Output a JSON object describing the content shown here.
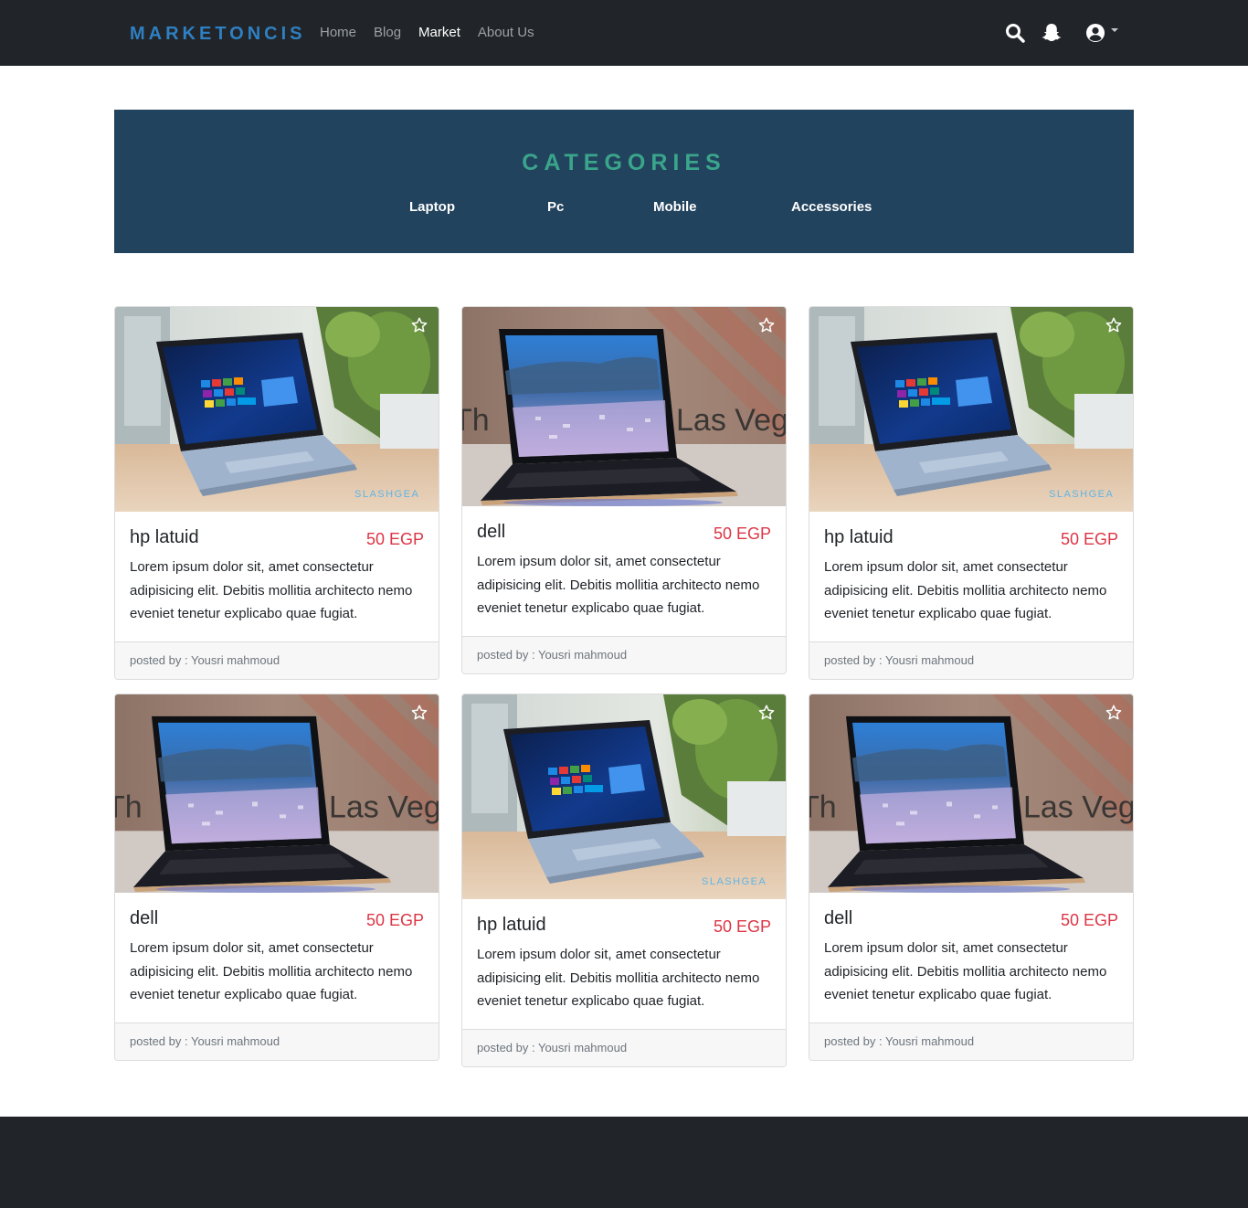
{
  "navbar": {
    "brand": "MARKETONCIS",
    "links": [
      {
        "label": "Home",
        "active": false
      },
      {
        "label": "Blog",
        "active": false
      },
      {
        "label": "Market",
        "active": true
      },
      {
        "label": "About Us",
        "active": false
      }
    ],
    "icons": [
      "search-icon",
      "snapchat-icon",
      "user-circle-icon",
      "caret-down-icon"
    ]
  },
  "categories": {
    "title": "CATEGORIES",
    "items": [
      "Laptop",
      "Pc",
      "Mobile",
      "Accessories"
    ]
  },
  "products": [
    {
      "name": "hp latuid",
      "price": "50 EGP",
      "description": "Lorem ipsum dolor sit, amet consectetur adipisicing elit. Debitis mollitia architecto nemo eveniet tenetur explicabo quae fugiat.",
      "posted_by": "posted by : Yousri mahmoud",
      "image": "surface-laptop",
      "watermark": "SLASHGEAR"
    },
    {
      "name": "dell",
      "price": "50 EGP",
      "description": "Lorem ipsum dolor sit, amet consectetur adipisicing elit. Debitis mollitia architecto nemo eveniet tenetur explicabo quae fugiat.",
      "posted_by": "posted by : Yousri mahmoud",
      "image": "dell-laptop",
      "backdrop_text": "Th Las Veg"
    },
    {
      "name": "hp latuid",
      "price": "50 EGP",
      "description": "Lorem ipsum dolor sit, amet consectetur adipisicing elit. Debitis mollitia architecto nemo eveniet tenetur explicabo quae fugiat.",
      "posted_by": "posted by : Yousri mahmoud",
      "image": "surface-laptop",
      "watermark": "SLASHGEAR"
    },
    {
      "name": "dell",
      "price": "50 EGP",
      "description": "Lorem ipsum dolor sit, amet consectetur adipisicing elit. Debitis mollitia architecto nemo eveniet tenetur explicabo quae fugiat.",
      "posted_by": "posted by : Yousri mahmoud",
      "image": "dell-laptop",
      "backdrop_text": "Th Las Veg"
    },
    {
      "name": "hp latuid",
      "price": "50 EGP",
      "description": "Lorem ipsum dolor sit, amet consectetur adipisicing elit. Debitis mollitia architecto nemo eveniet tenetur explicabo quae fugiat.",
      "posted_by": "posted by : Yousri mahmoud",
      "image": "surface-laptop",
      "watermark": "SLASHGEAR"
    },
    {
      "name": "dell",
      "price": "50 EGP",
      "description": "Lorem ipsum dolor sit, amet consectetur adipisicing elit. Debitis mollitia architecto nemo eveniet tenetur explicabo quae fugiat.",
      "posted_by": "posted by : Yousri mahmoud",
      "image": "dell-laptop",
      "backdrop_text": "Th Las Veg"
    }
  ],
  "colors": {
    "navbar_bg": "#212529",
    "brand": "#2f7fc1",
    "banner_bg": "#22435e",
    "banner_title": "#3aa58b",
    "price": "#dc3545"
  }
}
